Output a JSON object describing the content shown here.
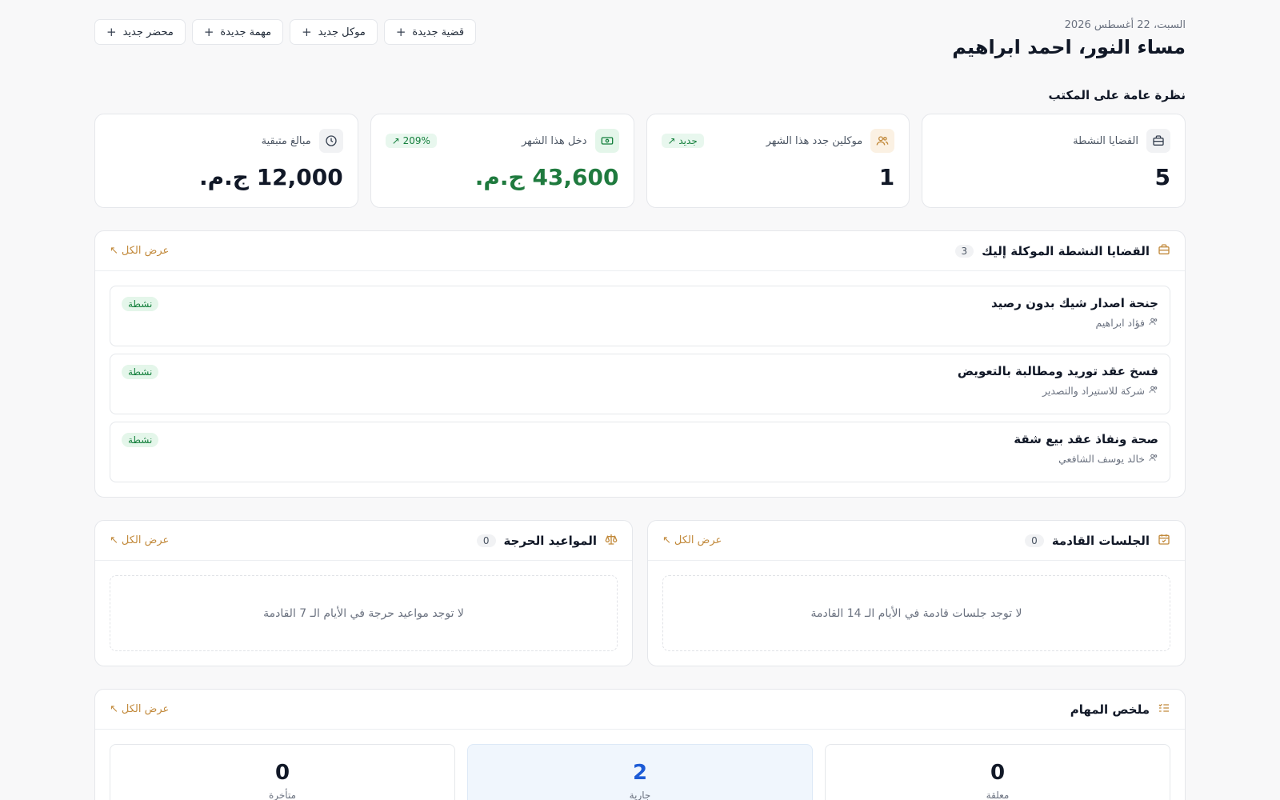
{
  "header": {
    "date": "السبت، 22 أغسطس 2026",
    "greeting": "مساء النور، احمد ابراهيم"
  },
  "actions": [
    {
      "label": "قضية جديدة"
    },
    {
      "label": "موكل جديد"
    },
    {
      "label": "مهمة جديدة"
    },
    {
      "label": "محضر جديد"
    }
  ],
  "overview_title": "نظرة عامة على المكتب",
  "stats": [
    {
      "label": "القضايا النشطة",
      "value": "5",
      "icon": "briefcase-icon"
    },
    {
      "label": "موكلين جدد هذا الشهر",
      "value": "1",
      "badge": "جديد",
      "icon": "users-icon"
    },
    {
      "label": "دخل هذا الشهر",
      "value": "43,600 ج.م.",
      "badge": "209%",
      "icon": "cash-icon"
    },
    {
      "label": "مبالغ متبقية",
      "value": "12,000 ج.م.",
      "icon": "clock-icon"
    }
  ],
  "active_cases": {
    "title": "القضايا النشطة الموكلة إليك",
    "count": "3",
    "view_all": "عرض الكل",
    "items": [
      {
        "title": "جنحة اصدار شيك بدون رصيد",
        "client": "فؤاد ابراهيم",
        "status": "نشطة"
      },
      {
        "title": "فسخ عقد توريد ومطالبة بالتعويض",
        "client": "شركة للاستيراد والتصدير",
        "status": "نشطة"
      },
      {
        "title": "صحة ونفاذ عقد بيع شقة",
        "client": "خالد يوسف الشافعي",
        "status": "نشطة"
      }
    ]
  },
  "sessions": {
    "title": "الجلسات القادمة",
    "count": "0",
    "view_all": "عرض الكل",
    "empty": "لا توجد جلسات قادمة في الأيام الـ 14 القادمة"
  },
  "deadlines": {
    "title": "المواعيد الحرجة",
    "count": "0",
    "view_all": "عرض الكل",
    "empty": "لا توجد مواعيد حرجة في الأيام الـ 7 القادمة"
  },
  "tasks": {
    "title": "ملخص المهام",
    "view_all": "عرض الكل",
    "boxes": [
      {
        "value": "0",
        "label": "معلقة"
      },
      {
        "value": "2",
        "label": "جارية"
      },
      {
        "value": "0",
        "label": "متأخرة"
      }
    ]
  },
  "colors": {
    "accent": "#c28a3c",
    "success": "#15803d",
    "info": "#1d5bd6"
  }
}
